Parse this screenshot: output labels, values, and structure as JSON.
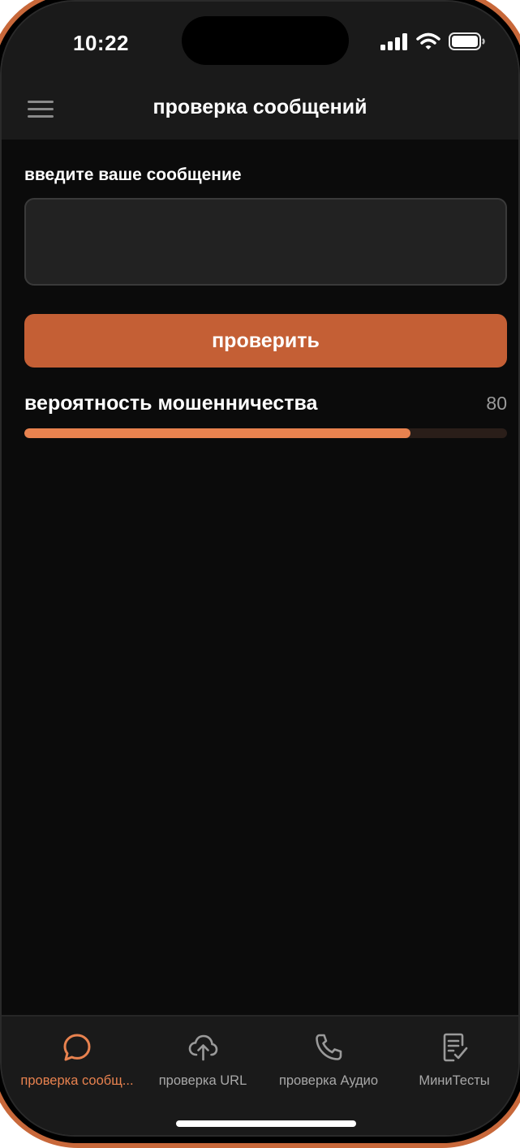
{
  "status_bar": {
    "time": "10:22"
  },
  "app_bar": {
    "title": "проверка сообщений",
    "menu_icon": "hamburger-menu-icon"
  },
  "form": {
    "input_label": "введите ваше сообщение",
    "input_value": "",
    "check_button_label": "проверить"
  },
  "result": {
    "label": "вероятность мошенничества",
    "value": "80",
    "progress_percent": 80
  },
  "tabs": [
    {
      "label": "проверка сообщ...",
      "icon": "chat-bubble-icon",
      "active": true
    },
    {
      "label": "проверка URL",
      "icon": "cloud-upload-icon",
      "active": false
    },
    {
      "label": "проверка Аудио",
      "icon": "phone-icon",
      "active": false
    },
    {
      "label": "МиниТесты",
      "icon": "checklist-icon",
      "active": false
    }
  ],
  "colors": {
    "accent": "#c45f35",
    "progress": "#e8824f",
    "background": "#0b0b0b",
    "surface": "#1a1a1a"
  }
}
